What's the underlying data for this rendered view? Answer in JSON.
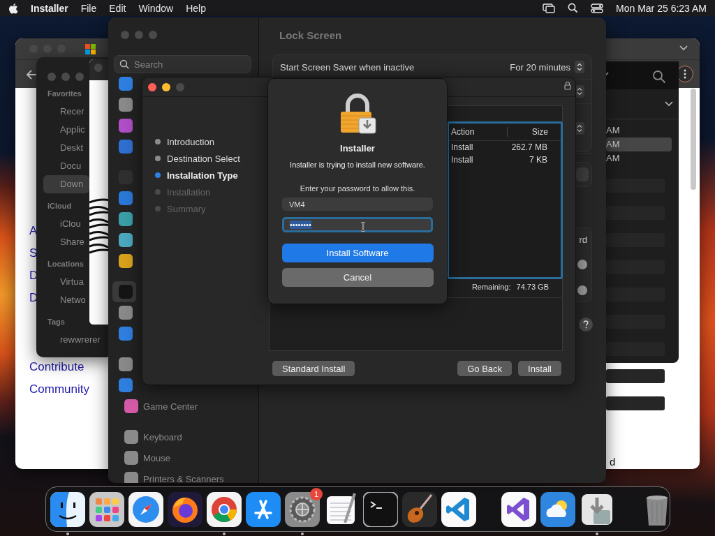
{
  "menu_bar": {
    "app": "Installer",
    "menus": [
      "File",
      "Edit",
      "Window",
      "Help"
    ],
    "clock": "Mon Mar 25  6:23 AM"
  },
  "browser_window": {
    "links": [
      "A",
      "S",
      "D",
      "D"
    ],
    "footer_links": [
      "Contribute",
      "Community"
    ],
    "corner_fragment": "d",
    "list_panel": {
      "rows": [
        {
          "time": "AM",
          "selected": false
        },
        {
          "time": "AM",
          "selected": true
        },
        {
          "time": "AM",
          "selected": false
        }
      ]
    }
  },
  "finder_window": {
    "sections": [
      {
        "title": "Favorites",
        "items": [
          {
            "label": "Recer",
            "selected": false
          },
          {
            "label": "Applic",
            "selected": false
          },
          {
            "label": "Deskt",
            "selected": false
          },
          {
            "label": "Docu",
            "selected": false
          },
          {
            "label": "Down",
            "selected": true
          }
        ]
      },
      {
        "title": "iCloud",
        "items": [
          {
            "label": "iClou",
            "selected": false
          },
          {
            "label": "Share",
            "selected": false
          }
        ]
      },
      {
        "title": "Locations",
        "items": [
          {
            "label": "Virtua",
            "selected": false
          },
          {
            "label": "Netwo",
            "selected": false
          }
        ]
      },
      {
        "title": "Tags",
        "items": [
          {
            "label": "rewwrerer",
            "selected": false
          }
        ]
      }
    ]
  },
  "settings_window": {
    "search": {
      "placeholder": "Search"
    },
    "sidebar": [
      [
        {
          "color": "#2f7fe0",
          "selected": false
        },
        {
          "color": "#8a8a8a",
          "selected": false
        },
        {
          "color": "#b04fc8",
          "selected": false
        },
        {
          "color": "#2e6fd0",
          "selected": false
        }
      ],
      [
        {
          "color": "#303030",
          "selected": false
        },
        {
          "color": "#2a78d8",
          "selected": false
        },
        {
          "color": "#3a9fa8",
          "selected": false
        },
        {
          "color": "#4aa8c0",
          "selected": false
        },
        {
          "color": "#d9a21c",
          "selected": false
        }
      ],
      [
        {
          "color": "#151515",
          "selected": true
        },
        {
          "color": "#8a8a8a",
          "selected": false
        },
        {
          "color": "#2f7fe0",
          "selected": false
        }
      ],
      [
        {
          "color": "#8a8a8a",
          "selected": false
        },
        {
          "color": "#2f7fe0",
          "selected": false
        },
        {
          "color": "#d45aa8",
          "selected": false,
          "label": "Game Center"
        }
      ],
      [
        {
          "color": "#8a8a8a",
          "selected": false,
          "label": "Keyboard"
        },
        {
          "color": "#8a8a8a",
          "selected": false,
          "label": "Mouse"
        },
        {
          "color": "#8a8a8a",
          "selected": false,
          "label": "Printers & Scanners"
        }
      ]
    ],
    "pane": {
      "title": "Lock Screen",
      "screen_saver": {
        "label": "Start Screen Saver when inactive",
        "value": "For 20 minutes"
      },
      "label_fragment": "rd"
    }
  },
  "installer_window": {
    "steps": [
      {
        "label": "Introduction",
        "selected": false,
        "disabled": false
      },
      {
        "label": "Destination Select",
        "selected": false,
        "disabled": false
      },
      {
        "label": "Installation Type",
        "selected": true,
        "disabled": false
      },
      {
        "label": "Installation",
        "selected": false,
        "disabled": true
      },
      {
        "label": "Summary",
        "selected": false,
        "disabled": true
      }
    ],
    "table": {
      "columns": [
        "Action",
        "Size"
      ],
      "rows": [
        [
          "Install",
          "262.7 MB"
        ],
        [
          "Install",
          "7 KB"
        ]
      ]
    },
    "remaining_label": "Remaining:",
    "remaining": "74.73 GB",
    "left_buttons": [
      "Standard Install"
    ],
    "right_buttons": [
      "Go Back",
      "Install"
    ]
  },
  "auth_dialog": {
    "title": "Installer",
    "message": "Installer is trying to install new software.",
    "prompt": "Enter your password to allow this.",
    "username": "VM4",
    "password": "••••••••",
    "buttons": [
      {
        "label": "Install Software",
        "kind": "default"
      },
      {
        "label": "Cancel",
        "kind": "normal"
      }
    ]
  },
  "dock": {
    "items": [
      {
        "kind": "finder",
        "running": true
      },
      {
        "kind": "launchpad",
        "running": false
      },
      {
        "kind": "safari",
        "running": false
      },
      {
        "kind": "firefox",
        "running": false
      },
      {
        "kind": "chrome",
        "running": true
      },
      {
        "kind": "appstore",
        "running": false
      },
      {
        "kind": "settings",
        "running": true,
        "badge": "1"
      },
      {
        "kind": "textedit",
        "running": false
      },
      {
        "kind": "terminal",
        "running": false
      },
      {
        "kind": "garageband",
        "running": false
      },
      {
        "kind": "vscode",
        "running": false
      },
      {
        "kind": "separator"
      },
      {
        "kind": "visualstudio",
        "running": false
      },
      {
        "kind": "weather",
        "running": false
      },
      {
        "kind": "installer",
        "running": true
      },
      {
        "kind": "separator"
      },
      {
        "kind": "trash",
        "running": false
      }
    ]
  }
}
